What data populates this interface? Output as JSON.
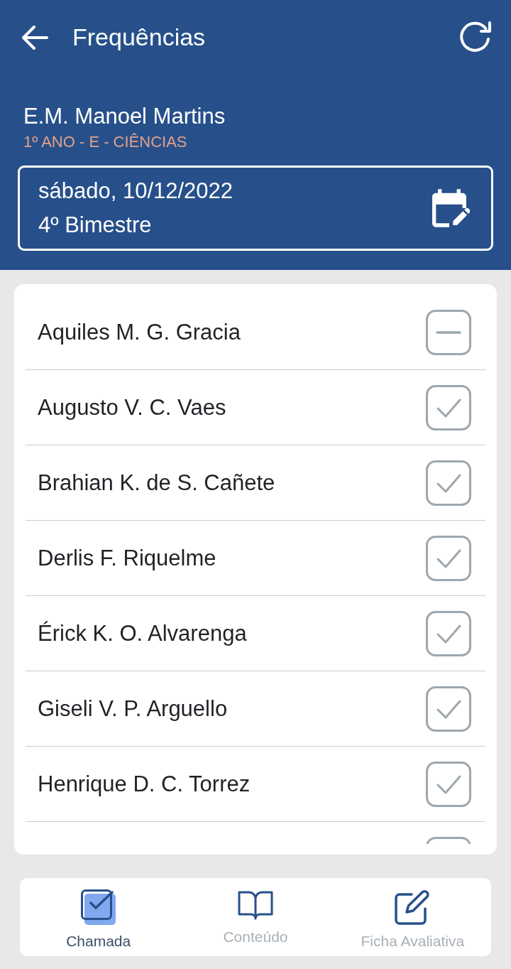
{
  "top_bar": {
    "title": "Frequências"
  },
  "class_info": {
    "school": "E.M. Manoel Martins",
    "class": "1º ANO - E - CIÊNCIAS"
  },
  "date_field": {
    "date": "sábado, 10/12/2022",
    "term": "4º Bimestre"
  },
  "students": [
    {
      "name": "Aquiles M. G. Gracia",
      "present": false
    },
    {
      "name": "Augusto V. C. Vaes",
      "present": true
    },
    {
      "name": "Brahian K. de S. Cañete",
      "present": true
    },
    {
      "name": "Derlis F. Riquelme",
      "present": true
    },
    {
      "name": "Érick K. O. Alvarenga",
      "present": true
    },
    {
      "name": "Giseli V. P. Arguello",
      "present": true
    },
    {
      "name": "Henrique D. C. Torrez",
      "present": true
    }
  ],
  "more_students_below": true,
  "tabs": [
    {
      "label": "Chamada",
      "selected": true
    },
    {
      "label": "Conteúdo",
      "selected": false
    },
    {
      "label": "Ficha Avaliativa",
      "selected": false
    }
  ]
}
